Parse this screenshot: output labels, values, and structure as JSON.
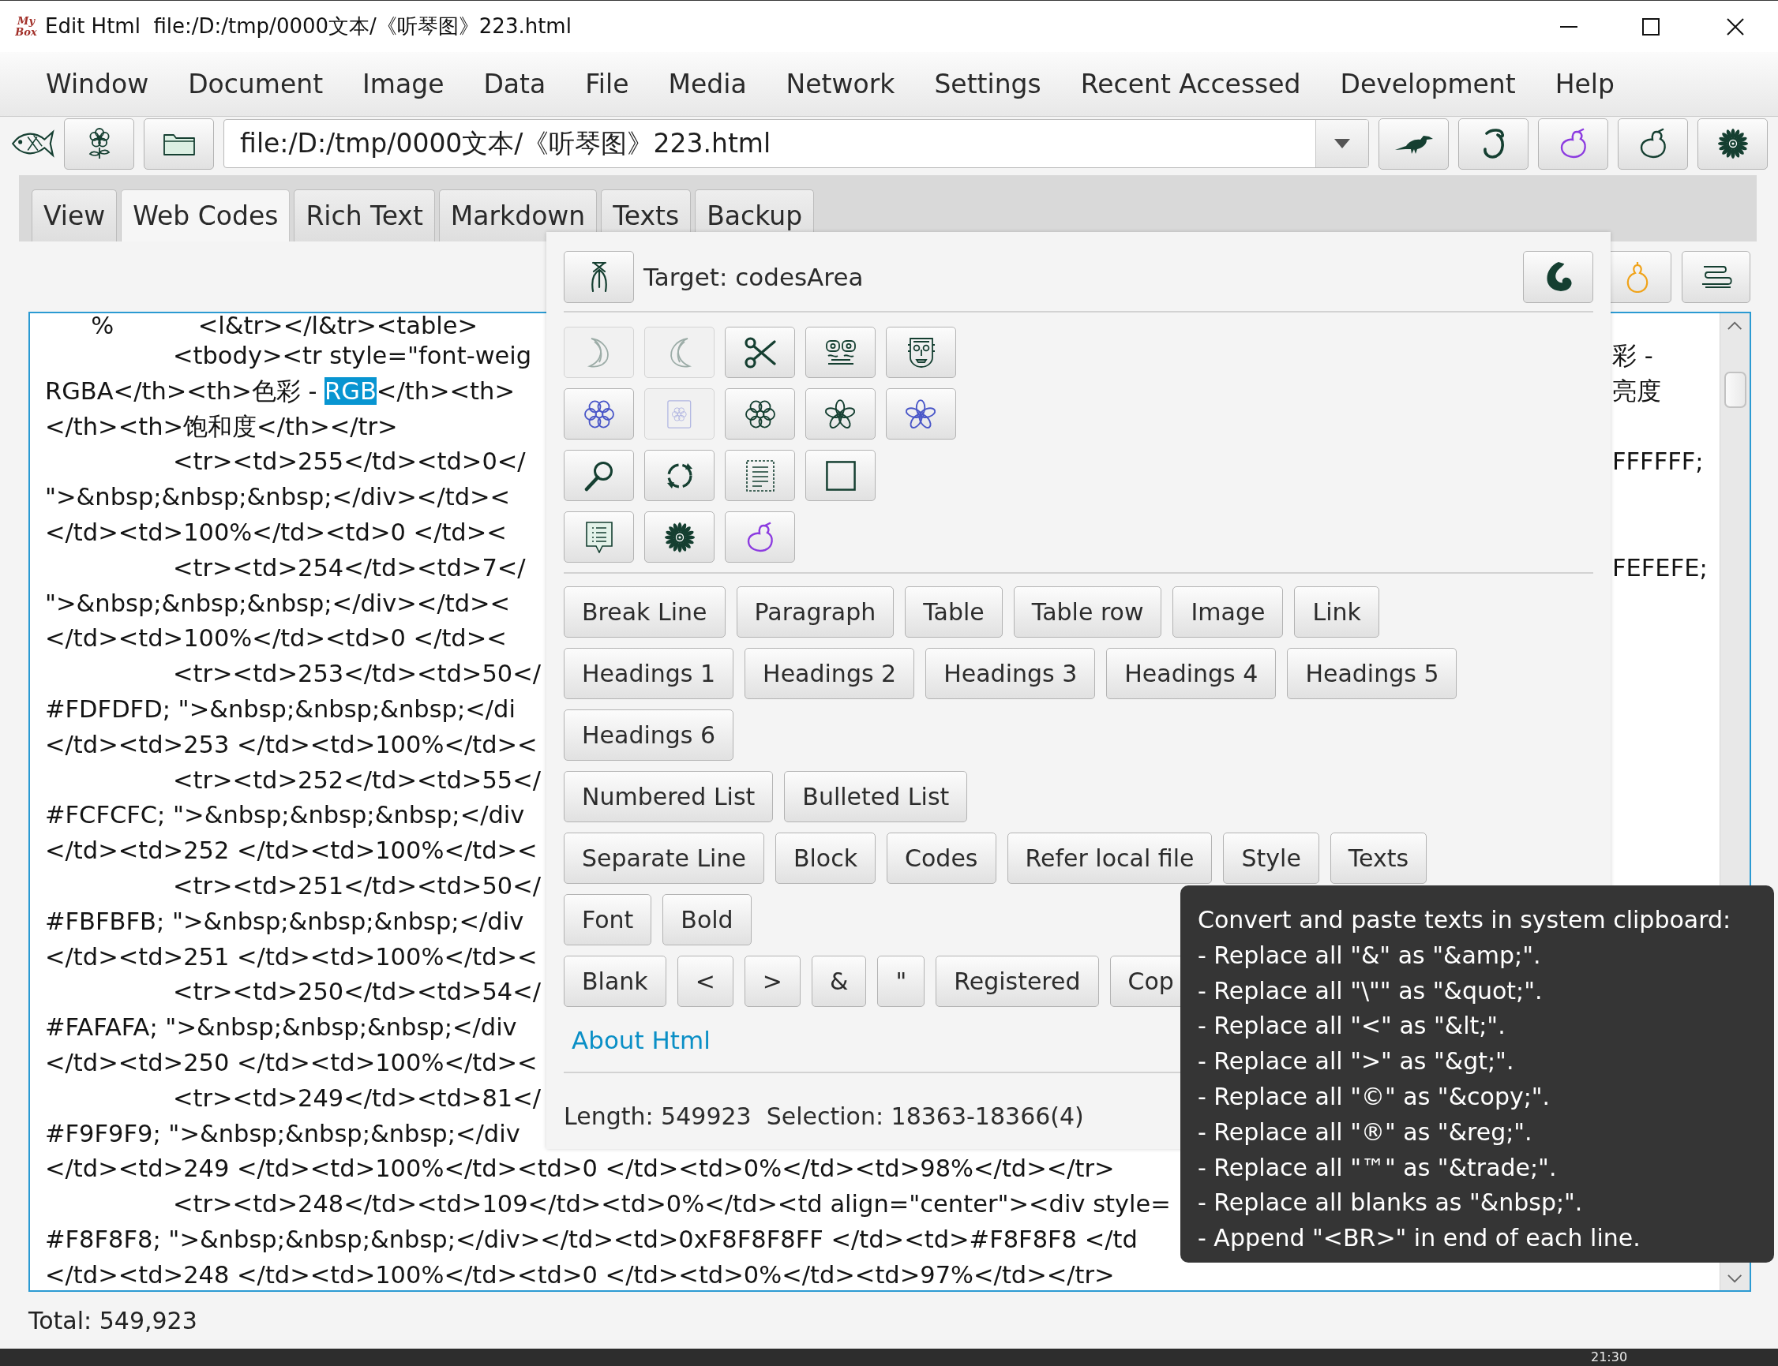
{
  "window": {
    "logo": "My Box",
    "title": "Edit Html  file:/D:/tmp/0000文本/《听琴图》223.html"
  },
  "menu": [
    "Window",
    "Document",
    "Image",
    "Data",
    "File",
    "Media",
    "Network",
    "Settings",
    "Recent Accessed",
    "Development",
    "Help"
  ],
  "address": {
    "value": "file:/D:/tmp/0000文本/《听琴图》223.html"
  },
  "tabs": [
    {
      "label": "View",
      "selected": false
    },
    {
      "label": "Web Codes",
      "selected": true
    },
    {
      "label": "Rich Text",
      "selected": false
    },
    {
      "label": "Markdown",
      "selected": false
    },
    {
      "label": "Texts",
      "selected": false
    },
    {
      "label": "Backup",
      "selected": false
    }
  ],
  "popup": {
    "target": "Target: codesArea",
    "icon_rows": [
      [
        {
          "disabled": true
        },
        {
          "disabled": true
        },
        {
          "disabled": false
        },
        {
          "disabled": false
        },
        {
          "disabled": false
        }
      ],
      [
        {
          "disabled": false
        },
        {
          "disabled": true
        },
        {
          "disabled": false
        },
        {
          "disabled": false
        },
        {
          "disabled": false
        }
      ],
      [
        {
          "disabled": false
        },
        {
          "disabled": false
        },
        {
          "disabled": false
        },
        {
          "disabled": false
        }
      ],
      [
        {
          "disabled": false
        },
        {
          "disabled": false
        },
        {
          "disabled": false
        }
      ]
    ],
    "button_rows": [
      [
        "Break Line",
        "Paragraph",
        "Table",
        "Table row",
        "Image",
        "Link"
      ],
      [
        "Headings 1",
        "Headings 2",
        "Headings 3",
        "Headings 4",
        "Headings 5"
      ],
      [
        "Headings 6"
      ],
      [
        "Numbered List",
        "Bulleted List"
      ],
      [
        "Separate Line",
        "Block",
        "Codes",
        "Refer local file",
        "Style",
        "Texts"
      ],
      [
        "Font",
        "Bold"
      ],
      [
        "Blank",
        "<",
        ">",
        "&",
        "\"",
        "Registered",
        "Cop"
      ]
    ],
    "link": "About Html",
    "status": "Length: 549923  Selection: 18363-18366(4)"
  },
  "editor": {
    "lines": [
      {
        "text": "      %           <l&tr></l&tr><table>"
      },
      {
        "text": "\t\t<tbody><tr style=\"font-weig",
        "end_text": "彩 -"
      },
      {
        "segments": [
          {
            "text": "RGBA</th><th>色彩 - ",
            "selected": false
          },
          {
            "text": "RGB",
            "selected": true
          },
          {
            "text": "</th><th>",
            "selected": false
          }
        ],
        "end_text": "亮度"
      },
      {
        "text": "</th><th>饱和度</th></tr>"
      },
      {
        "text": "\t\t<tr><td>255</td><td>0</",
        "end_text": "FFFFFF;"
      },
      {
        "text": "\">&nbsp;&nbsp;&nbsp;</div></td><"
      },
      {
        "text": "</td><td>100%</td><td>0 </td><"
      },
      {
        "text": "\t\t<tr><td>254</td><td>7</",
        "end_text": "FEFEFE;"
      },
      {
        "text": "\">&nbsp;&nbsp;&nbsp;</div></td><"
      },
      {
        "text": "</td><td>100%</td><td>0 </td><"
      },
      {
        "text": "\t\t<tr><td>253</td><td>50</"
      },
      {
        "text": "#FDFDFD; \">&nbsp;&nbsp;&nbsp;</di"
      },
      {
        "text": "</td><td>253 </td><td>100%</td><"
      },
      {
        "text": "\t\t<tr><td>252</td><td>55</"
      },
      {
        "text": "#FCFCFC; \">&nbsp;&nbsp;&nbsp;</div"
      },
      {
        "text": "</td><td>252 </td><td>100%</td><"
      },
      {
        "text": "\t\t<tr><td>251</td><td>50</"
      },
      {
        "text": "#FBFBFB; \">&nbsp;&nbsp;&nbsp;</div"
      },
      {
        "text": "</td><td>251 </td><td>100%</td><"
      },
      {
        "text": "\t\t<tr><td>250</td><td>54</"
      },
      {
        "text": "#FAFAFA; \">&nbsp;&nbsp;&nbsp;</div"
      },
      {
        "text": "</td><td>250 </td><td>100%</td><"
      },
      {
        "text": "\t\t<tr><td>249</td><td>81</"
      },
      {
        "text": "#F9F9F9; \">&nbsp;&nbsp;&nbsp;</div"
      },
      {
        "text": "</td><td>249 </td><td>100%</td><td>0 </td><td>0%</td><td>98%</td></tr>"
      },
      {
        "text": "\t\t<tr><td>248</td><td>109</td><td>0%</td><td align=\"center\"><div style="
      },
      {
        "text": "#F8F8F8; \">&nbsp;&nbsp;&nbsp;</div></td><td>0xF8F8F8FF </td><td>#F8F8F8 </td"
      },
      {
        "text": "</td><td>248 </td><td>100%</td><td>0 </td><td>0%</td><td>97%</td></tr>"
      }
    ]
  },
  "status_bar": "Total: 549,923",
  "tooltip": {
    "lines": [
      "Convert and paste texts in system clipboard:",
      "- Replace all \"&\" as \"&amp;\".",
      "- Replace all \"\\\"\" as \"&quot;\".",
      "- Replace all \"<\" as \"&lt;\".",
      "- Replace all \">\" as \"&gt;\".",
      "- Replace all \"©\" as \"&copy;\".",
      "- Replace all \"®\" as \"&reg;\".",
      "- Replace all \"™\" as \"&trade;\".",
      "- Replace all blanks as \"&nbsp;\".",
      "- Append \"<BR>\" in end of each line."
    ]
  },
  "taskbar": {
    "clock": "21:30"
  }
}
